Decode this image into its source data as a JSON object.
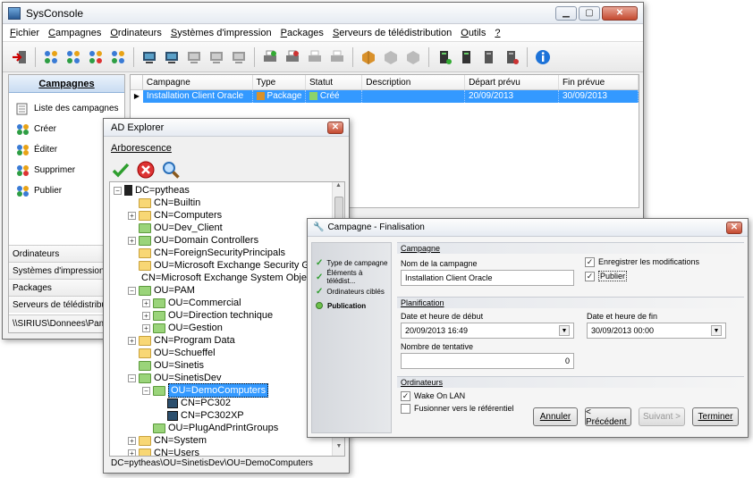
{
  "main_window": {
    "title": "SysConsole",
    "menu": [
      "Fichier",
      "Campagnes",
      "Ordinateurs",
      "Systèmes d'impression",
      "Packages",
      "Serveurs de télédistribution",
      "Outils",
      "?"
    ],
    "sidebar": {
      "header": "Campagnes",
      "items": [
        "Liste des campagnes",
        "Créer",
        "Éditer",
        "Supprimer",
        "Publier"
      ],
      "bottom_sections": [
        "Ordinateurs",
        "Systèmes d'impression",
        "Packages",
        "Serveurs de télédistribution"
      ]
    },
    "status_path": "\\\\SIRIUS\\Donnees\\PamRo",
    "table": {
      "columns": [
        "Campagne",
        "Type",
        "Statut",
        "Description",
        "Départ prévu",
        "Fin prévue"
      ],
      "rows": [
        {
          "campagne": "Installation Client Oracle",
          "type": "Package",
          "statut": "Créé",
          "description": "",
          "depart": "20/09/2013",
          "fin": "30/09/2013"
        }
      ]
    }
  },
  "ad_explorer": {
    "title": "AD Explorer",
    "section": "Arborescence",
    "tree": [
      {
        "label": "DC=pytheas",
        "level": 0,
        "exp": "−",
        "icon": "server"
      },
      {
        "label": "CN=Builtin",
        "level": 1,
        "exp": "",
        "icon": "folder"
      },
      {
        "label": "CN=Computers",
        "level": 1,
        "exp": "+",
        "icon": "folder"
      },
      {
        "label": "OU=Dev_Client",
        "level": 1,
        "exp": "",
        "icon": "ou"
      },
      {
        "label": "OU=Domain Controllers",
        "level": 1,
        "exp": "+",
        "icon": "ou"
      },
      {
        "label": "CN=ForeignSecurityPrincipals",
        "level": 1,
        "exp": "",
        "icon": "folder"
      },
      {
        "label": "OU=Microsoft Exchange Security Group",
        "level": 1,
        "exp": "",
        "icon": "folder"
      },
      {
        "label": "CN=Microsoft Exchange System Objects",
        "level": 1,
        "exp": "",
        "icon": "none"
      },
      {
        "label": "OU=PAM",
        "level": 1,
        "exp": "−",
        "icon": "ou"
      },
      {
        "label": "OU=Commercial",
        "level": 2,
        "exp": "+",
        "icon": "ou"
      },
      {
        "label": "OU=Direction technique",
        "level": 2,
        "exp": "+",
        "icon": "ou"
      },
      {
        "label": "OU=Gestion",
        "level": 2,
        "exp": "+",
        "icon": "ou"
      },
      {
        "label": "CN=Program Data",
        "level": 1,
        "exp": "+",
        "icon": "folder"
      },
      {
        "label": "OU=Schueffel",
        "level": 1,
        "exp": "",
        "icon": "folder"
      },
      {
        "label": "OU=Sinetis",
        "level": 1,
        "exp": "",
        "icon": "ou"
      },
      {
        "label": "OU=SinetisDev",
        "level": 1,
        "exp": "−",
        "icon": "ou"
      },
      {
        "label": "OU=DemoComputers",
        "level": 2,
        "exp": "−",
        "icon": "ou",
        "selected": true
      },
      {
        "label": "CN=PC302",
        "level": 3,
        "exp": "",
        "icon": "computer"
      },
      {
        "label": "CN=PC302XP",
        "level": 3,
        "exp": "",
        "icon": "computer"
      },
      {
        "label": "OU=PlugAndPrintGroups",
        "level": 2,
        "exp": "",
        "icon": "ou"
      },
      {
        "label": "CN=System",
        "level": 1,
        "exp": "+",
        "icon": "folder"
      },
      {
        "label": "CN=Users",
        "level": 1,
        "exp": "+",
        "icon": "folder"
      }
    ],
    "status": "DC=pytheas\\OU=SinetisDev\\OU=DemoComputers"
  },
  "wizard": {
    "title": "Campagne - Finalisation",
    "steps": [
      {
        "label": "Type de campagne",
        "state": "done"
      },
      {
        "label": "Éléments à télédist...",
        "state": "done"
      },
      {
        "label": "Ordinateurs ciblés",
        "state": "done"
      },
      {
        "label": "Publication",
        "state": "current"
      }
    ],
    "groups": {
      "campagne": "Campagne",
      "planification": "Planification",
      "ordinateurs": "Ordinateurs"
    },
    "fields": {
      "nom_label": "Nom de la campagne",
      "nom_value": "Installation Client Oracle",
      "enregistrer_label": "Enregistrer les modifications",
      "publier_label": "Publier",
      "debut_label": "Date et heure de début",
      "debut_value": "20/09/2013 16:49",
      "fin_label": "Date et heure de fin",
      "fin_value": "30/09/2013 00:00",
      "tentatives_label": "Nombre de tentative",
      "tentatives_value": "0",
      "wol_label": "Wake On LAN",
      "fusion_label": "Fusionner vers le référentiel"
    },
    "buttons": {
      "annuler": "Annuler",
      "precedent": "< Précédent",
      "suivant": "Suivant >",
      "terminer": "Terminer"
    }
  }
}
